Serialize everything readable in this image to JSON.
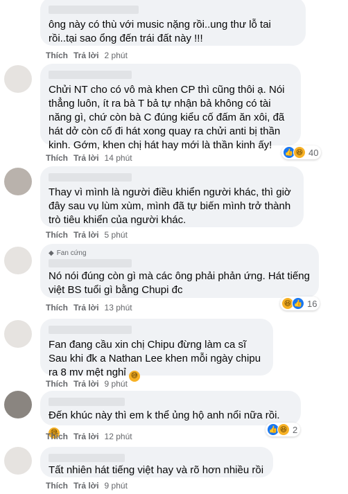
{
  "comments": [
    {
      "text": "ông này có thù với music nặng rồi..ung thư lỗ tai rồi..tại sao ổng đến trái đất này !!!",
      "like": "Thích",
      "reply": "Trả lời",
      "time": "2 phút"
    },
    {
      "text": "Chửi NT cho có vô mà khen CP thì cũng thôi ạ. Nói thẳng luôn, ít ra bà T bả tự nhận bả không có tài năng gì, chứ còn bà C đúng kiểu cố đấm ăn xôi, đã hát dở còn cố đi hát xong quay ra chửi anti bị thần kinh. Gớm, khen chị hát hay mới là thần kinh ấy!",
      "like": "Thích",
      "reply": "Trả lời",
      "time": "14 phút",
      "reaction_count": "40"
    },
    {
      "text": "Thay vì mình là người điều khiển người khác, thì giờ đây sau vụ lùm xùm, mình đã tự biến mình trở thành trò tiêu khiển của người khác.",
      "like": "Thích",
      "reply": "Trả lời",
      "time": "5 phút"
    },
    {
      "badge": "Fan cứng",
      "text": "Nó nói đúng còn gì mà các ông phải phản ứng. Hát tiếng việt BS tuổi gì bằng Chupi đc",
      "like": "Thích",
      "reply": "Trả lời",
      "time": "13 phút",
      "reaction_count": "16"
    },
    {
      "text": "Fan đang cầu xin chị Chipu đừng làm ca sĩ\nSau khi đk a Nathan Lee khen mỗi ngày chipu ra 8 mv mệt nghỉ",
      "like": "Thích",
      "reply": "Trả lời",
      "time": "9 phút"
    },
    {
      "text": "Đến khúc này thì em k thể ủng hộ anh nổi nữa rồi.",
      "like": "Thích",
      "reply": "Trả lời",
      "time": "12 phút",
      "reaction_count": "2"
    },
    {
      "text": "Tất nhiên hát tiếng việt hay và rõ hơn nhiều rồi",
      "like": "Thích",
      "reply": "Trả lời",
      "time": "9 phút"
    }
  ],
  "icons": {
    "like": "like-reaction-icon",
    "haha": "haha-reaction-icon",
    "fan": "diamond-icon"
  },
  "colors": {
    "bubble": "#f0f2f5",
    "meta": "#65676b",
    "like": "#1877f2",
    "haha": "#f7b125"
  }
}
